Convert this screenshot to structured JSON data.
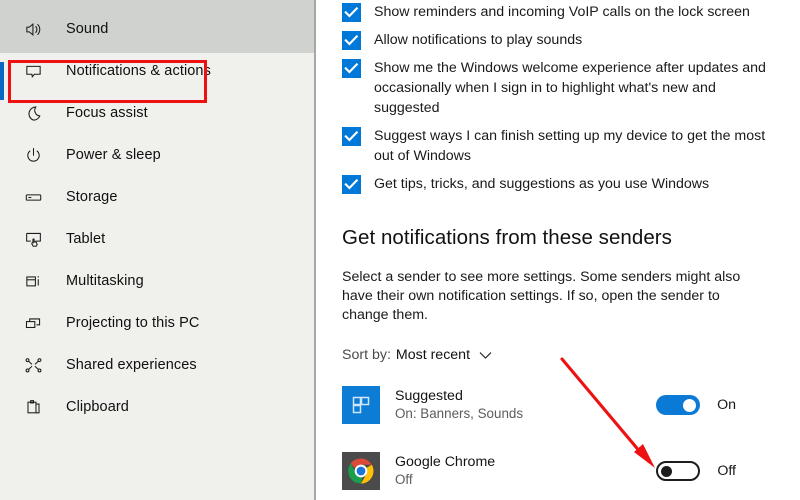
{
  "sidebar": {
    "items": [
      {
        "label": "Sound",
        "icon": "speaker-icon",
        "selected": false
      },
      {
        "label": "Notifications & actions",
        "icon": "notification-balloon-icon",
        "selected": true
      },
      {
        "label": "Focus assist",
        "icon": "moon-icon",
        "selected": false
      },
      {
        "label": "Power & sleep",
        "icon": "power-icon",
        "selected": false
      },
      {
        "label": "Storage",
        "icon": "drive-icon",
        "selected": false
      },
      {
        "label": "Tablet",
        "icon": "tablet-icon",
        "selected": false
      },
      {
        "label": "Multitasking",
        "icon": "multitasking-icon",
        "selected": false
      },
      {
        "label": "Projecting to this PC",
        "icon": "projecting-icon",
        "selected": false
      },
      {
        "label": "Shared experiences",
        "icon": "share-nodes-icon",
        "selected": false
      },
      {
        "label": "Clipboard",
        "icon": "clipboard-icon",
        "selected": false
      }
    ]
  },
  "main": {
    "checkboxes": [
      {
        "label": "Show reminders and incoming VoIP calls on the lock screen",
        "checked": true
      },
      {
        "label": "Allow notifications to play sounds",
        "checked": true
      },
      {
        "label": "Show me the Windows welcome experience after updates and occasionally when I sign in to highlight what's new and suggested",
        "checked": true
      },
      {
        "label": "Suggest ways I can finish setting up my device to get the most out of Windows",
        "checked": true
      },
      {
        "label": "Get tips, tricks, and suggestions as you use Windows",
        "checked": true
      }
    ],
    "senders_heading": "Get notifications from these senders",
    "senders_description": "Select a sender to see more settings. Some senders might also have their own notification settings. If so, open the sender to change them.",
    "sort": {
      "label": "Sort by:",
      "value": "Most recent",
      "chevron": "chevron-down-icon"
    },
    "senders": [
      {
        "name": "Suggested",
        "subtitle": "On: Banners, Sounds",
        "icon": "suggested-tiles-icon",
        "toggle_state": "On",
        "toggle_on": true
      },
      {
        "name": "Google Chrome",
        "subtitle": "Off",
        "icon": "chrome-icon",
        "toggle_state": "Off",
        "toggle_on": false
      }
    ]
  },
  "annotations": {
    "highlight_box_color": "#ee1111",
    "arrow_color": "#ee1111",
    "arrow_target": "Google Chrome notification toggle"
  },
  "colors": {
    "accent_blue": "#0078d7",
    "sidebar_background": "#f0f0ec",
    "sidebar_top_band": "#cfd2ce",
    "selected_accent_bar": "#0a68c4",
    "main_background": "#ffffff",
    "divider": "#a6a6a6"
  }
}
